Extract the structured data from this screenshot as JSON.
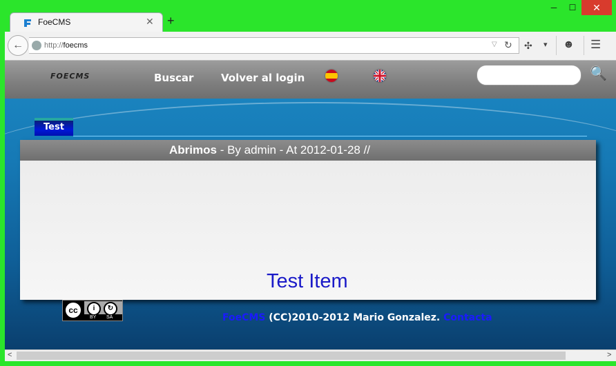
{
  "window": {
    "min_glyph": "─",
    "max_glyph": "☐",
    "close_glyph": "✕"
  },
  "tab": {
    "title": "FoeCMS",
    "close_glyph": "✕",
    "new_tab_glyph": "+"
  },
  "navbar": {
    "url_prefix": "http://",
    "url_host": "foecms",
    "back_glyph": "←",
    "reload_glyph": "↻",
    "dropdown_glyph": "▽",
    "menu_glyph": "☰",
    "smiley_glyph": "☻",
    "addon_glyph": "✣",
    "arrow_glyph": "▾"
  },
  "site": {
    "logo_text": "FOECMS",
    "nav": {
      "search": "Buscar",
      "login": "Volver al login"
    },
    "flags": {
      "es": "es-flag",
      "uk": "uk-flag"
    },
    "search_placeholder": "",
    "search_glyph": "🔍"
  },
  "content": {
    "tab_label": "Test",
    "post": {
      "title": "Abrimos",
      "meta": " - By admin - At 2012-01-28 //"
    },
    "item_text": "Test Item"
  },
  "footer": {
    "cc": {
      "cc": "cc",
      "by": "BY",
      "sa": "SA",
      "i": "i"
    },
    "brand": "FoeCMS",
    "copyright": " (CC)2010-2012 Mario Gonzalez. ",
    "contact": "Contacta"
  },
  "scrollbar": {
    "left": "<",
    "right": ">"
  },
  "colors": {
    "titlebar": "#2be52b",
    "link": "#1a1aff",
    "item_text": "#1a1ac8"
  }
}
